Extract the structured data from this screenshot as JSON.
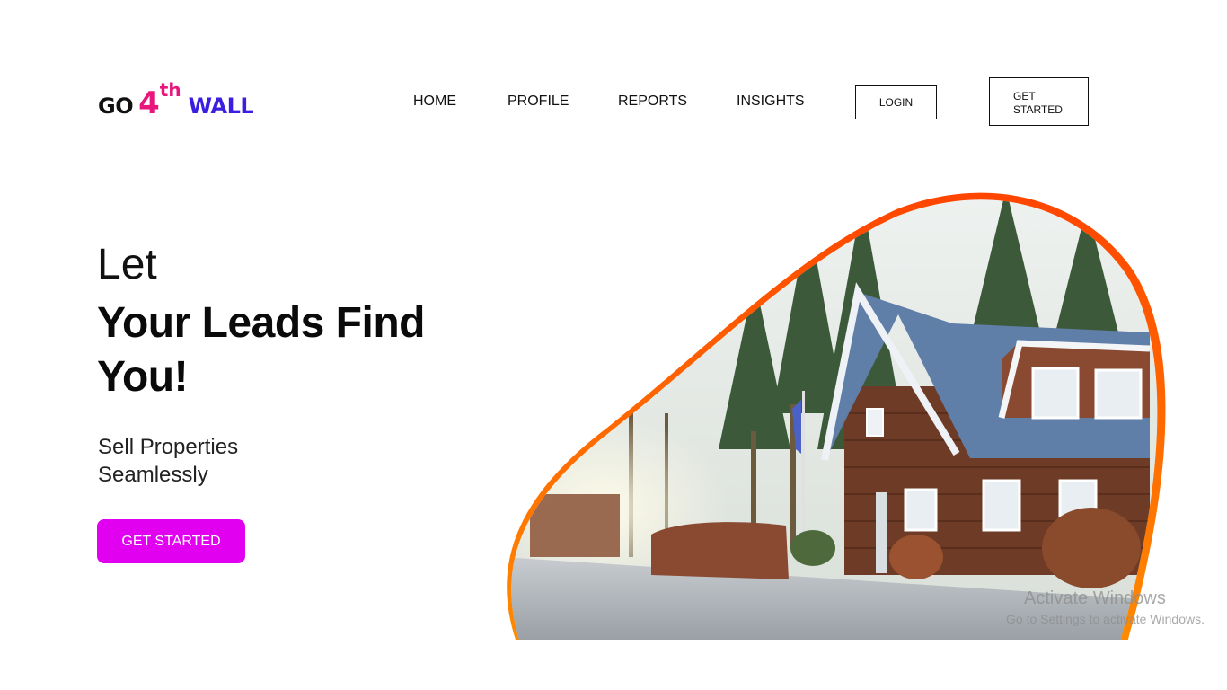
{
  "brand": {
    "go": "GO",
    "four": "4",
    "th": "th",
    "wall": "WALL",
    "colors": {
      "go": "#111111",
      "four": "#e8157d",
      "wall": "#3b1fe0"
    }
  },
  "nav": {
    "items": [
      "HOME",
      "PROFILE",
      "REPORTS",
      "INSIGHTS"
    ],
    "login": "LOGIN",
    "get_started": "GET\nSTARTED"
  },
  "hero": {
    "line1": "Let",
    "headline": "Your Leads Find You!",
    "subtitle": "Sell Properties Seamlessly",
    "cta": "GET STARTED",
    "cta_color": "#e100f0",
    "image": "house-photo",
    "frame_color": "#ff5a00"
  },
  "watermark": {
    "line1": "Activate Windows",
    "line2": "Go to Settings to activate Windows."
  }
}
